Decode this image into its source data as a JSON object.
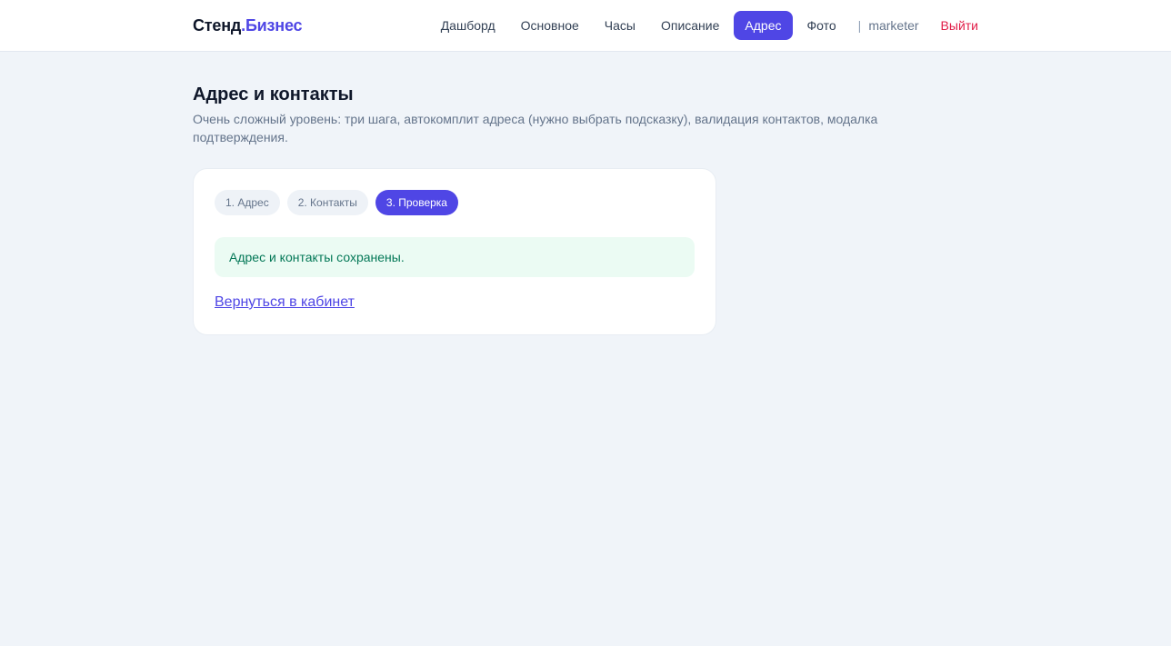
{
  "header": {
    "brand_part1": "Стенд",
    "brand_dot": ".",
    "brand_part2": "Бизнес",
    "nav": [
      {
        "label": "Дашборд",
        "active": false
      },
      {
        "label": "Основное",
        "active": false
      },
      {
        "label": "Часы",
        "active": false
      },
      {
        "label": "Описание",
        "active": false
      },
      {
        "label": "Адрес",
        "active": true
      },
      {
        "label": "Фото",
        "active": false
      }
    ],
    "separator": "|",
    "username": "marketer",
    "logout_label": "Выйти"
  },
  "page": {
    "title": "Адрес и контакты",
    "description": "Очень сложный уровень: три шага, автокомплит адреса (нужно выбрать подсказку), валидация контактов, модалка подтверждения."
  },
  "wizard": {
    "steps": [
      {
        "label": "1. Адрес",
        "active": false
      },
      {
        "label": "2. Контакты",
        "active": false
      },
      {
        "label": "3. Проверка",
        "active": true
      }
    ],
    "success_message": "Адрес и контакты сохранены.",
    "back_link": "Вернуться в кабинет"
  },
  "colors": {
    "accent": "#4f46e5",
    "background": "#f0f4f9",
    "success_bg": "#ebfbf3",
    "success_text": "#047857",
    "logout": "#e11d48"
  }
}
